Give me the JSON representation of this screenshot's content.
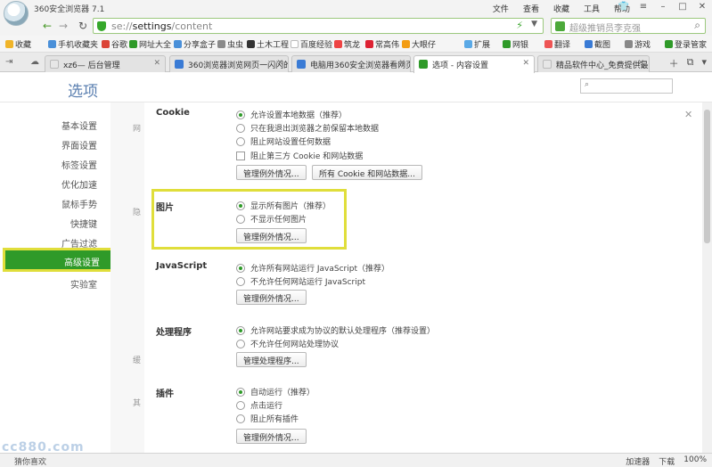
{
  "titlebar": {
    "app_title": "360安全浏览器 7.1",
    "menu": [
      "文件",
      "查看",
      "收藏",
      "工具",
      "帮助"
    ]
  },
  "address": {
    "prefix": "se://",
    "host": "settings",
    "path": "/content",
    "search_placeholder": "超级推销员李克强"
  },
  "bookmarks": [
    {
      "label": "收藏",
      "color": "#f0b429"
    },
    {
      "label": "手机收藏夹",
      "color": "#4a90d9"
    },
    {
      "label": "谷歌",
      "color": "#db4437"
    },
    {
      "label": "网址大全",
      "color": "#2f9a29"
    },
    {
      "label": "分享盒子",
      "color": "#4a90d9"
    },
    {
      "label": "虫虫",
      "color": "#8a8a8a"
    },
    {
      "label": "土木工程",
      "color": "#333333"
    },
    {
      "label": "百度经验",
      "color": "#ffffff"
    },
    {
      "label": "筑龙",
      "color": "#e44"
    },
    {
      "label": "常高伟",
      "color": "#d23"
    },
    {
      "label": "大眼仔",
      "color": "#f39c12"
    },
    {
      "label": "扩展",
      "color": "#5aa9e6"
    },
    {
      "label": "网银",
      "color": "#2f9a29"
    },
    {
      "label": "翻译",
      "color": "#e55"
    },
    {
      "label": "截图",
      "color": "#3a7bd5"
    },
    {
      "label": "游戏",
      "color": "#888"
    },
    {
      "label": "登录管家",
      "color": "#2f9a29"
    }
  ],
  "tabs": [
    {
      "label": "xz6— 后台管理",
      "active": false,
      "color": "#e7e7e7"
    },
    {
      "label": "360浏览器浏览网页一闪闪的",
      "active": false,
      "color": "#3a7bd5"
    },
    {
      "label": "电脑用360安全浏览器看网页",
      "active": false,
      "color": "#3a7bd5"
    },
    {
      "label": "选项 - 内容设置",
      "active": true,
      "color": "#2f9a29"
    },
    {
      "label": "精品软件中心_免费提供最新",
      "active": false,
      "color": "#e7e7e7"
    }
  ],
  "page": {
    "title": "选项",
    "search_icon": "search-icon"
  },
  "sidebar": {
    "items": [
      "基本设置",
      "界面设置",
      "标签设置",
      "优化加速",
      "鼠标手势",
      "快捷键",
      "广告过滤",
      "高级设置",
      "实验室"
    ],
    "active_index": 7
  },
  "ghost_labels": [
    "网",
    "隐",
    "缓",
    "其"
  ],
  "sections": {
    "cookie": {
      "title": "Cookie",
      "options": [
        {
          "label": "允许设置本地数据（推荐）",
          "type": "radio",
          "checked": true
        },
        {
          "label": "只在我退出浏览器之前保留本地数据",
          "type": "radio",
          "checked": false
        },
        {
          "label": "阻止网站设置任何数据",
          "type": "radio",
          "checked": false
        },
        {
          "label": "阻止第三方 Cookie 和网站数据",
          "type": "checkbox",
          "checked": false
        }
      ],
      "buttons": [
        "管理例外情况...",
        "所有 Cookie 和网站数据..."
      ]
    },
    "images": {
      "title": "图片",
      "options": [
        {
          "label": "显示所有图片（推荐）",
          "type": "radio",
          "checked": true
        },
        {
          "label": "不显示任何图片",
          "type": "radio",
          "checked": false
        }
      ],
      "buttons": [
        "管理例外情况..."
      ]
    },
    "javascript": {
      "title": "JavaScript",
      "options": [
        {
          "label": "允许所有网站运行 JavaScript（推荐）",
          "type": "radio",
          "checked": true
        },
        {
          "label": "不允许任何网站运行 JavaScript",
          "type": "radio",
          "checked": false
        }
      ],
      "buttons": [
        "管理例外情况..."
      ]
    },
    "handlers": {
      "title": "处理程序",
      "options": [
        {
          "label": "允许网站要求成为协议的默认处理程序（推荐设置）",
          "type": "radio",
          "checked": true
        },
        {
          "label": "不允许任何网站处理协议",
          "type": "radio",
          "checked": false
        }
      ],
      "buttons": [
        "管理处理程序..."
      ]
    },
    "plugins": {
      "title": "插件",
      "options": [
        {
          "label": "自动运行（推荐）",
          "type": "radio",
          "checked": true
        },
        {
          "label": "点击运行",
          "type": "radio",
          "checked": false
        },
        {
          "label": "阻止所有插件",
          "type": "radio",
          "checked": false
        }
      ],
      "buttons": [
        "管理例外情况..."
      ]
    }
  },
  "statusbar": {
    "left_text": "猜你喜欢",
    "watermark": "cc880.com",
    "right_items": [
      "加速器",
      "下载",
      "100%"
    ]
  }
}
